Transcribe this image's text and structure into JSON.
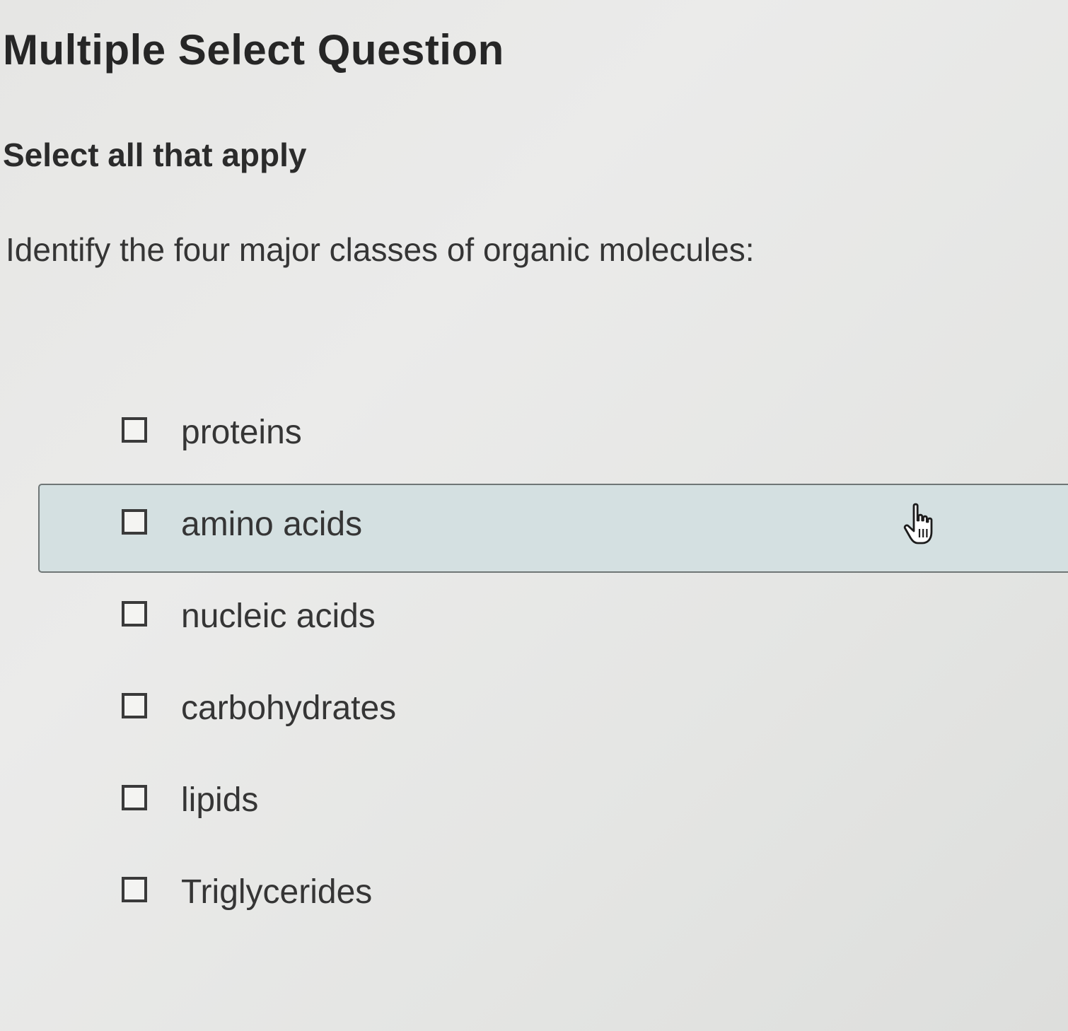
{
  "title": "Multiple Select Question",
  "instruction": "Select all that apply",
  "question": "Identify the four major classes of organic molecules:",
  "options": [
    {
      "label": "proteins",
      "checked": false
    },
    {
      "label": "amino acids",
      "checked": false
    },
    {
      "label": "nucleic acids",
      "checked": false
    },
    {
      "label": "carbohydrates",
      "checked": false
    },
    {
      "label": "lipids",
      "checked": false
    },
    {
      "label": "Triglycerides",
      "checked": false
    }
  ],
  "hovered_option_index": 1,
  "cursor_icon": "hand-pointer-icon",
  "colors": {
    "hover_background": "#d4e0e1",
    "hover_border": "#6f7676",
    "text": "#353535"
  }
}
